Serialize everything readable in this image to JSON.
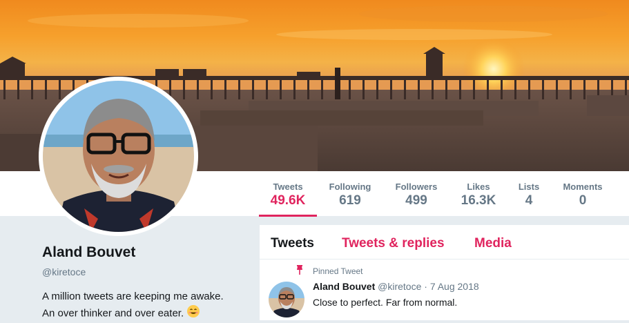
{
  "colors": {
    "accent": "#e0245e",
    "text_primary": "#14171a",
    "text_secondary": "#657786",
    "page_background": "#e6ecf0"
  },
  "profile": {
    "name": "Aland Bouvet",
    "handle": "@kiretoce",
    "bio_line1": "A million tweets are keeping me awake.",
    "bio_line2": "An over thinker and over eater.",
    "bio_emoji": "smiling-face-icon"
  },
  "stats": [
    {
      "label": "Tweets",
      "value": "49.6K",
      "active": true
    },
    {
      "label": "Following",
      "value": "619",
      "active": false
    },
    {
      "label": "Followers",
      "value": "499",
      "active": false
    },
    {
      "label": "Likes",
      "value": "16.3K",
      "active": false
    },
    {
      "label": "Lists",
      "value": "4",
      "active": false
    },
    {
      "label": "Moments",
      "value": "0",
      "active": false
    }
  ],
  "tabs": [
    {
      "label": "Tweets",
      "selected": true
    },
    {
      "label": "Tweets & replies",
      "selected": false
    },
    {
      "label": "Media",
      "selected": false
    }
  ],
  "pinned_tweet": {
    "pinned_label": "Pinned Tweet",
    "pin_icon": "pin-icon",
    "author_name": "Aland Bouvet",
    "author_handle": "@kiretoce",
    "separator": "·",
    "date": "7 Aug 2018",
    "text": "Close to perfect. Far from normal."
  }
}
